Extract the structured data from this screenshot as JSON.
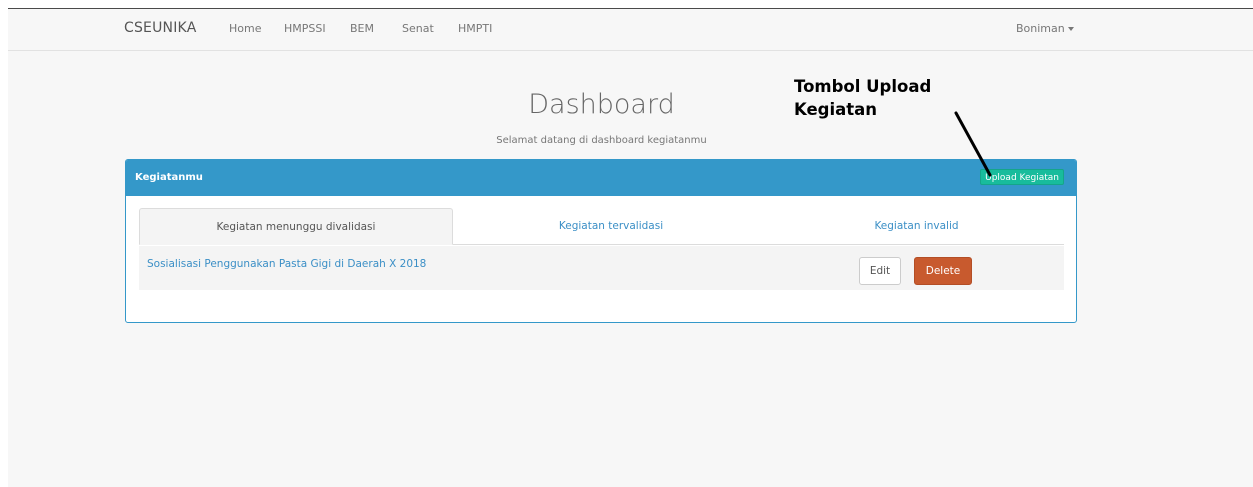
{
  "navbar": {
    "brand": "CSEUNIKA",
    "links": [
      "Home",
      "HMPSSI",
      "BEM",
      "Senat",
      "HMPTI"
    ],
    "user": "Boniman"
  },
  "header": {
    "title": "Dashboard",
    "subtitle": "Selamat datang di dashboard kegiatanmu"
  },
  "annotation": {
    "line1": "Tombol Upload",
    "line2": "Kegiatan"
  },
  "panel": {
    "title": "Kegiatanmu",
    "upload_label": "Upload Kegiatan",
    "tabs": [
      {
        "label": "Kegiatan menunggu divalidasi",
        "active": true
      },
      {
        "label": "Kegiatan tervalidasi",
        "active": false
      },
      {
        "label": "Kegiatan invalid",
        "active": false
      }
    ],
    "rows": [
      {
        "title": "Sosialisasi Penggunakan Pasta Gigi di Daerah X 2018",
        "edit_label": "Edit",
        "delete_label": "Delete"
      }
    ]
  },
  "colors": {
    "primary": "#3498c9",
    "success": "#18bc9c",
    "danger": "#c85a2e",
    "link": "#3b8fc6"
  }
}
